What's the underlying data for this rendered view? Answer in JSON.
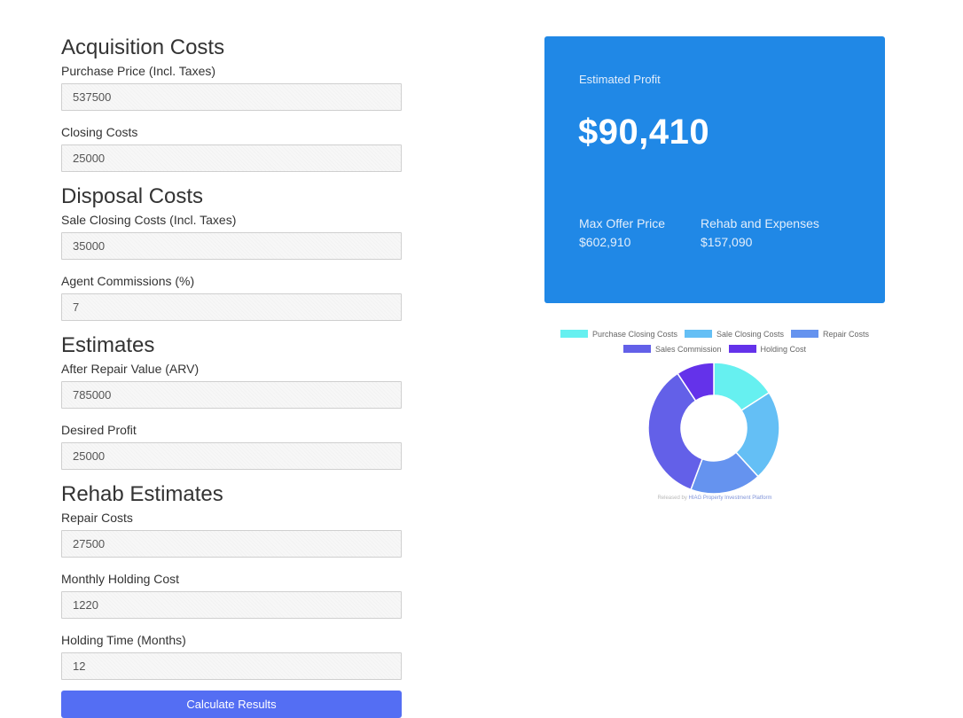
{
  "sections": {
    "acquisition": {
      "title": "Acquisition Costs",
      "purchase_price_label": "Purchase Price (Incl. Taxes)",
      "purchase_price_value": "537500",
      "closing_costs_label": "Closing Costs",
      "closing_costs_value": "25000"
    },
    "disposal": {
      "title": "Disposal Costs",
      "sale_closing_label": "Sale Closing Costs (Incl. Taxes)",
      "sale_closing_value": "35000",
      "agent_commissions_label": "Agent Commissions (%)",
      "agent_commissions_value": "7"
    },
    "estimates": {
      "title": "Estimates",
      "arv_label": "After Repair Value (ARV)",
      "arv_value": "785000",
      "desired_profit_label": "Desired Profit",
      "desired_profit_value": "25000"
    },
    "rehab": {
      "title": "Rehab Estimates",
      "repair_label": "Repair Costs",
      "repair_value": "27500",
      "monthly_holding_label": "Monthly Holding Cost",
      "monthly_holding_value": "1220",
      "holding_time_label": "Holding Time (Months)",
      "holding_time_value": "12"
    }
  },
  "calculate_label": "Calculate Results",
  "summary": {
    "estimated_profit_label": "Estimated Profit",
    "estimated_profit_value": "$90,410",
    "max_offer_label": "Max Offer Price",
    "max_offer_value": "$602,910",
    "rehab_expenses_label": "Rehab and Expenses",
    "rehab_expenses_value": "$157,090",
    "card_color": "#2088e6"
  },
  "button_color": "#546ef3",
  "chart_data": {
    "type": "pie",
    "donut": true,
    "categories": [
      "Purchase Closing Costs",
      "Sale Closing Costs",
      "Repair Costs",
      "Sales Commission",
      "Holding Cost"
    ],
    "values": [
      25000,
      35000,
      27500,
      54950,
      14640
    ],
    "colors": [
      "#66f0f0",
      "#64bff5",
      "#6593ef",
      "#6360e8",
      "#6432ea"
    ],
    "legend": "top",
    "credit_prefix": "Released by",
    "credit_link": "HIAG Property Investment Platform"
  }
}
